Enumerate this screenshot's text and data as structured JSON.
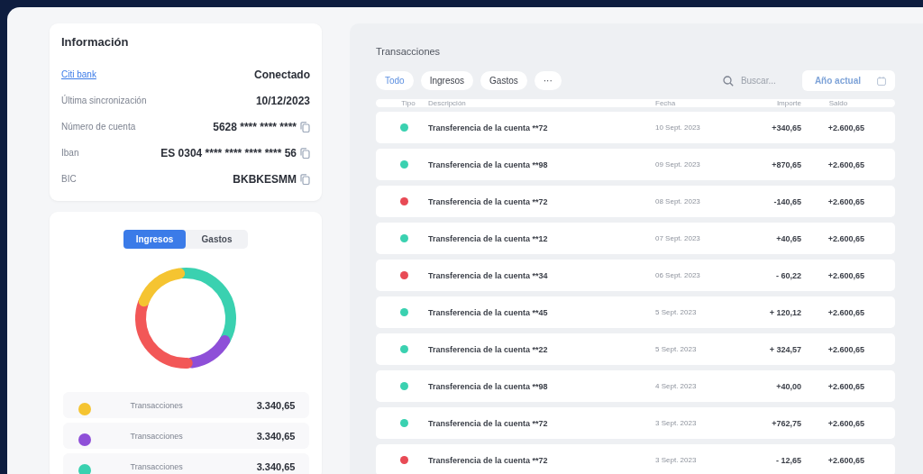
{
  "info": {
    "title": "Información",
    "bank": {
      "name": "Citi bank",
      "status": "Conectado"
    },
    "fields": [
      {
        "label": "Última sincronización",
        "value": "10/12/2023",
        "copy": false
      },
      {
        "label": "Número de cuenta",
        "value": "5628 **** **** ****",
        "copy": true
      },
      {
        "label": "Iban",
        "value": "ES 0304 **** **** **** **** 56",
        "copy": true
      },
      {
        "label": "BIC",
        "value": "BKBKESMM",
        "copy": true
      }
    ]
  },
  "summary": {
    "tabs": [
      {
        "label": "Ingresos",
        "selected": true
      },
      {
        "label": "Gastos",
        "selected": false
      }
    ],
    "legend": [
      {
        "label": "Transacciones",
        "value": "3.340,65",
        "color": "#f5c431"
      },
      {
        "label": "Transacciones",
        "value": "3.340,65",
        "color": "#8e4fd8"
      },
      {
        "label": "Transacciones",
        "value": "3.340,65",
        "color": "#3ad1b0"
      }
    ]
  },
  "transactions": {
    "title": "Transacciones",
    "filters": [
      {
        "label": "Todo",
        "selected": true
      },
      {
        "label": "Ingresos",
        "selected": false
      },
      {
        "label": "Gastos",
        "selected": false
      },
      {
        "label": "···",
        "selected": false
      }
    ],
    "search": {
      "placeholder": "Buscar..."
    },
    "period": "Año actual",
    "columns": [
      "Tipo",
      "Descripción",
      "Fecha",
      "Importe",
      "Saldo"
    ],
    "rows": [
      {
        "color": "#3ad1b0",
        "description": "Transferencia de la cuenta **72",
        "date": "10 Sept. 2023",
        "amount": "+340,65",
        "balance": "+2.600,65"
      },
      {
        "color": "#3ad1b0",
        "description": "Transferencia de la cuenta **98",
        "date": "09 Sept. 2023",
        "amount": "+870,65",
        "balance": "+2.600,65"
      },
      {
        "color": "#e84a55",
        "description": "Transferencia de la cuenta **72",
        "date": "08 Sept. 2023",
        "amount": "-140,65",
        "balance": "+2.600,65"
      },
      {
        "color": "#3ad1b0",
        "description": "Transferencia de la cuenta **12",
        "date": "07 Sept. 2023",
        "amount": "+40,65",
        "balance": "+2.600,65"
      },
      {
        "color": "#e84a55",
        "description": "Transferencia de la cuenta **34",
        "date": "06 Sept. 2023",
        "amount": "- 60,22",
        "balance": "+2.600,65"
      },
      {
        "color": "#3ad1b0",
        "description": "Transferencia de la cuenta **45",
        "date": "5 Sept. 2023",
        "amount": "+ 120,12",
        "balance": "+2.600,65"
      },
      {
        "color": "#3ad1b0",
        "description": "Transferencia de la cuenta **22",
        "date": "5 Sept. 2023",
        "amount": "+ 324,57",
        "balance": "+2.600,65"
      },
      {
        "color": "#3ad1b0",
        "description": "Transferencia de la cuenta **98",
        "date": "4 Sept. 2023",
        "amount": "+40,00",
        "balance": "+2.600,65"
      },
      {
        "color": "#3ad1b0",
        "description": "Transferencia de la cuenta **72",
        "date": "3 Sept. 2023",
        "amount": "+762,75",
        "balance": "+2.600,65"
      },
      {
        "color": "#e84a55",
        "description": "Transferencia de la cuenta **72",
        "date": "3 Sept. 2023",
        "amount": "- 12,65",
        "balance": "+2.600,65"
      }
    ]
  }
}
